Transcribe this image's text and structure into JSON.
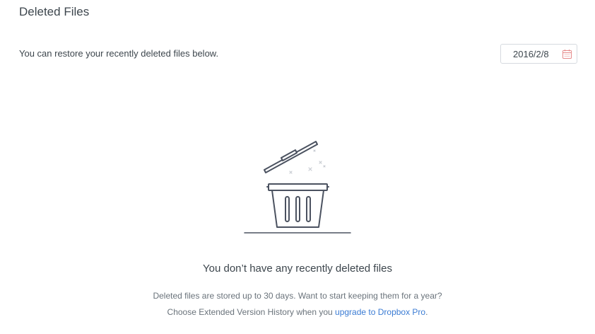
{
  "header": {
    "title": "Deleted Files"
  },
  "toolbar": {
    "subtitle": "You can restore your recently deleted files below.",
    "date_value": "2016/2/8",
    "calendar_icon": "calendar-icon"
  },
  "empty_state": {
    "illustration_icon": "trash-can-icon",
    "title": "You don’t have any recently deleted files",
    "line1": "Deleted files are stored up to 30 days. Want to start keeping them for a year?",
    "line2_prefix": "Choose Extended Version History when you ",
    "link_label": "upgrade to Dropbox Pro",
    "line2_suffix": "."
  },
  "colors": {
    "link": "#3b7cd4",
    "illustration_stroke": "#4b5260",
    "calendar_accent": "#e58a8a"
  }
}
